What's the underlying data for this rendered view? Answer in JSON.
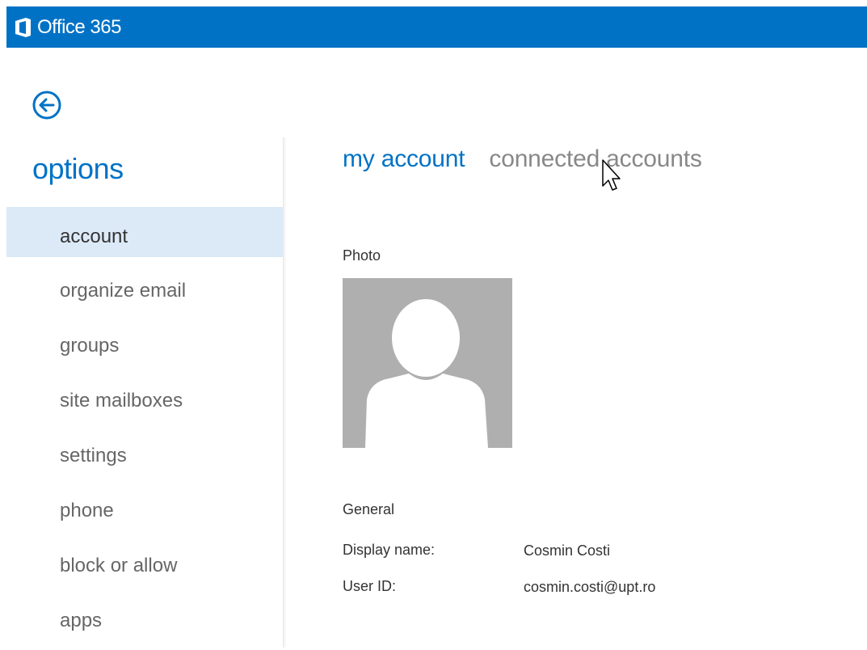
{
  "app": {
    "brand": "Office 365",
    "accent_color": "#0072c6",
    "logo_icon": "office-logo-icon",
    "back_icon": "back-arrow-circle-icon"
  },
  "sidebar": {
    "title": "options",
    "items": [
      {
        "label": "account",
        "active": true
      },
      {
        "label": "organize email",
        "active": false
      },
      {
        "label": "groups",
        "active": false
      },
      {
        "label": "site mailboxes",
        "active": false
      },
      {
        "label": "settings",
        "active": false
      },
      {
        "label": "phone",
        "active": false
      },
      {
        "label": "block or allow",
        "active": false
      },
      {
        "label": "apps",
        "active": false
      }
    ]
  },
  "main": {
    "tabs": [
      {
        "label": "my account",
        "active": true
      },
      {
        "label": "connected accounts",
        "active": false
      }
    ],
    "photo": {
      "label": "Photo",
      "placeholder_icon": "default-person-avatar-icon"
    },
    "general": {
      "label": "General",
      "fields": [
        {
          "label": "Display name:",
          "value": "Cosmin Costi"
        },
        {
          "label": "User ID:",
          "value": "cosmin.costi@upt.ro"
        }
      ]
    }
  }
}
